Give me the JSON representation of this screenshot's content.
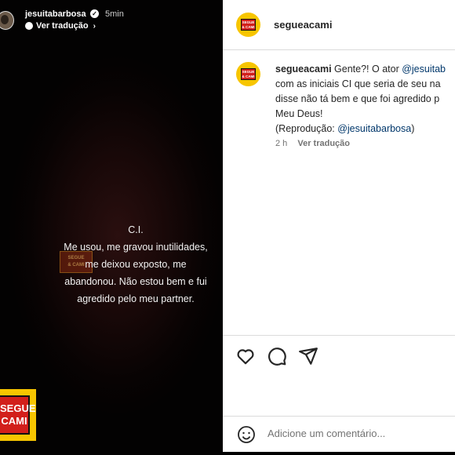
{
  "story": {
    "username": "jesuitabarbosa",
    "time": "5min",
    "translate_label": "Ver tradução",
    "text_lines": [
      "C.I.",
      "Me usou, me gravou inutilidades,",
      "me deixou exposto, me",
      "abandonou. Não estou bem e fui",
      "agredido pelo meu partner."
    ],
    "watermark_line1": "SEGUE",
    "watermark_line2": "& CAMI",
    "logo_line1": "SEGUE",
    "logo_line2": "CAMI"
  },
  "post": {
    "header_username": "segueacami",
    "avatar_line1": "SEGUE",
    "avatar_line2": "& CAMI",
    "comment": {
      "username": "segueacami",
      "line1_text": " Gente?! O ator ",
      "line1_mention": "@jesuitab",
      "line2": "com as iniciais CI que seria de seu na",
      "line3": "disse não tá bem e que foi agredido p",
      "line4": "Meu Deus!",
      "line5_prefix": "(Reprodução: ",
      "line5_mention": "@jesuitabarbosa",
      "line5_suffix": ")"
    },
    "time": "2 h",
    "translate_label": "Ver tradução",
    "add_comment_placeholder": "Adicione um comentário..."
  },
  "colors": {
    "brand_yellow": "#f7c500",
    "brand_red": "#d21f1b",
    "mention": "#00376b",
    "muted": "#737373"
  },
  "icons": [
    "verified-icon",
    "globe-icon",
    "chevron-right-icon",
    "heart-icon",
    "comment-icon",
    "share-icon",
    "emoji-icon"
  ]
}
